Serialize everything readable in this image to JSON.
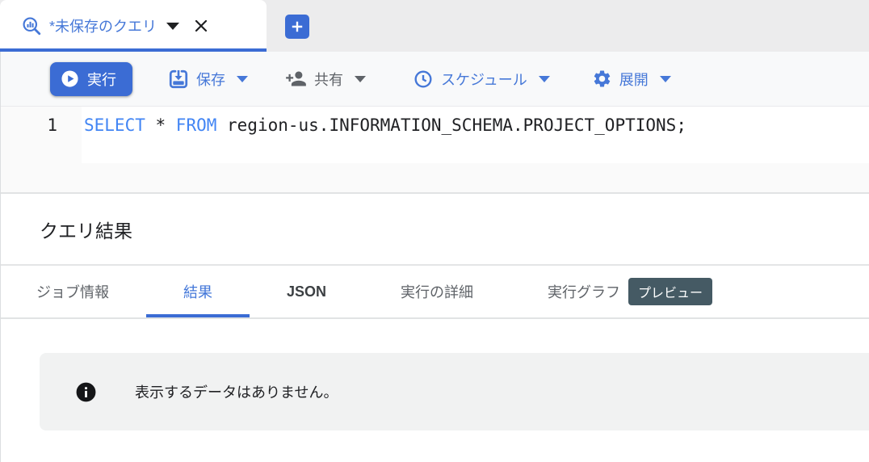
{
  "colors": {
    "accent_blue": "#3b6cd4",
    "label_blue": "#4678d8",
    "keyword_blue": "#4285f4",
    "gray_text": "#5f6368",
    "dark_text": "#202124",
    "badge_bg": "#455a64",
    "banner_bg": "#f1f2f2"
  },
  "tab_strip": {
    "tab": {
      "title": "*未保存のクエリ",
      "icon": "query-magnifier-icon"
    },
    "new_tab_icon": "plus-icon"
  },
  "toolbar": {
    "run_label": "実行",
    "save_label": "保存",
    "share_label": "共有",
    "schedule_label": "スケジュール",
    "expand_label": "展開",
    "icons": {
      "run": "play-circle-icon",
      "save": "save-icon",
      "share": "person-add-icon",
      "schedule": "clock-icon",
      "expand": "gear-icon"
    }
  },
  "editor": {
    "line_number": "1",
    "tokens": [
      {
        "text": "SELECT",
        "type": "kw"
      },
      {
        "text": " * ",
        "type": "pl"
      },
      {
        "text": "FROM",
        "type": "kw"
      },
      {
        "text": " region-us.INFORMATION_SCHEMA.PROJECT_OPTIONS;",
        "type": "pl"
      }
    ]
  },
  "results": {
    "title": "クエリ結果",
    "tabs": [
      {
        "label": "ジョブ情報"
      },
      {
        "label": "結果",
        "active": true
      },
      {
        "label": "JSON"
      },
      {
        "label": "実行の詳細"
      },
      {
        "label": "実行グラフ",
        "badge": "プレビュー"
      }
    ],
    "empty_message": "表示するデータはありません。",
    "empty_icon": "info-icon"
  }
}
